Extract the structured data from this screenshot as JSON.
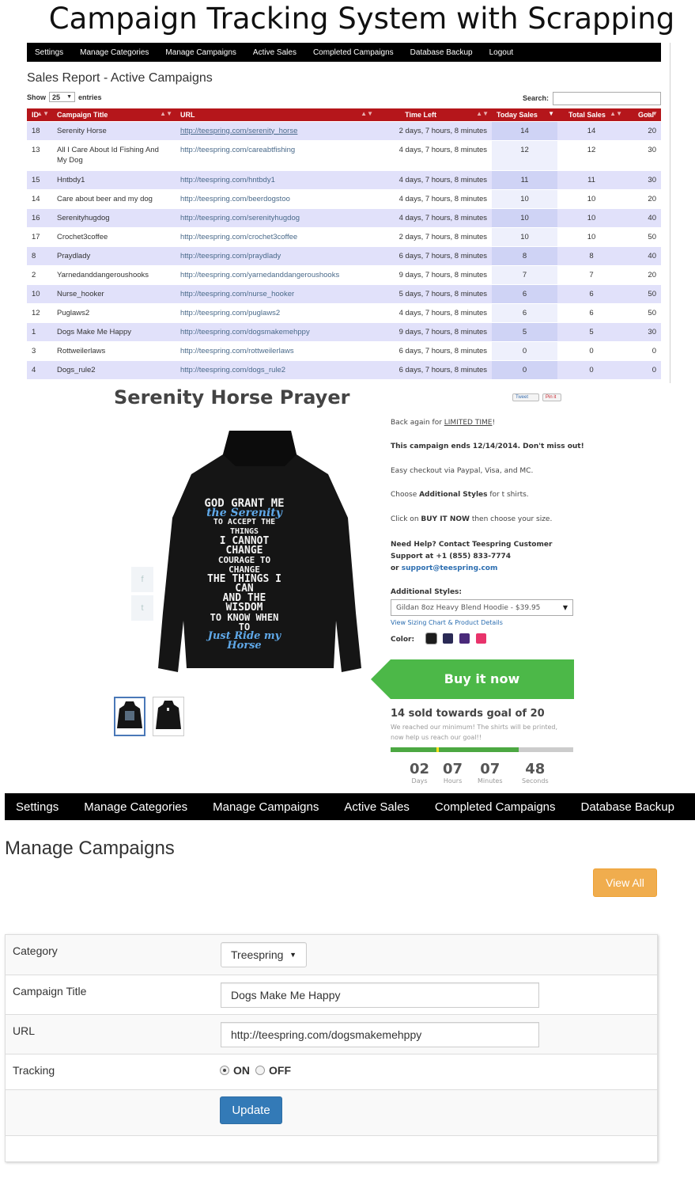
{
  "banner_title": "Campaign Tracking System with Scrapping",
  "nav_top": [
    "Settings",
    "Manage Categories",
    "Manage Campaigns",
    "Active Sales",
    "Completed Campaigns",
    "Database Backup",
    "Logout"
  ],
  "sales_report": {
    "title": "Sales Report - Active Campaigns",
    "show_label": "Show",
    "entries_value": "25",
    "entries_label": "entries",
    "search_label": "Search:",
    "columns": [
      "ID",
      "Campaign Title",
      "URL",
      "Time Left",
      "Today Sales",
      "Total Sales",
      "Goal"
    ],
    "rows": [
      [
        "18",
        "Serenity Horse",
        "http://teespring.com/serenity_horse",
        "2 days, 7 hours, 8 minutes",
        "14",
        "14",
        "20"
      ],
      [
        "13",
        "All I Care About Id Fishing And My Dog",
        "http://teespring.com/careabtfishing",
        "4 days, 7 hours, 8 minutes",
        "12",
        "12",
        "30"
      ],
      [
        "15",
        "Hntbdy1",
        "http://teespring.com/hntbdy1",
        "4 days, 7 hours, 8 minutes",
        "11",
        "11",
        "30"
      ],
      [
        "14",
        "Care about beer and my dog",
        "http://teespring.com/beerdogstoo",
        "4 days, 7 hours, 8 minutes",
        "10",
        "10",
        "20"
      ],
      [
        "16",
        "Serenityhugdog",
        "http://teespring.com/serenityhugdog",
        "4 days, 7 hours, 8 minutes",
        "10",
        "10",
        "40"
      ],
      [
        "17",
        "Crochet3coffee",
        "http://teespring.com/crochet3coffee",
        "2 days, 7 hours, 8 minutes",
        "10",
        "10",
        "50"
      ],
      [
        "8",
        "Praydlady",
        "http://teespring.com/praydlady",
        "6 days, 7 hours, 8 minutes",
        "8",
        "8",
        "40"
      ],
      [
        "2",
        "Yarnedanddangeroushooks",
        "http://teespring.com/yarnedanddangeroushooks",
        "9 days, 7 hours, 8 minutes",
        "7",
        "7",
        "20"
      ],
      [
        "10",
        "Nurse_hooker",
        "http://teespring.com/nurse_hooker",
        "5 days, 7 hours, 8 minutes",
        "6",
        "6",
        "50"
      ],
      [
        "12",
        "Puglaws2",
        "http://teespring.com/puglaws2",
        "4 days, 7 hours, 8 minutes",
        "6",
        "6",
        "50"
      ],
      [
        "1",
        "Dogs Make Me Happy",
        "http://teespring.com/dogsmakemehppy",
        "9 days, 7 hours, 8 minutes",
        "5",
        "5",
        "30"
      ],
      [
        "3",
        "Rottweilerlaws",
        "http://teespring.com/rottweilerlaws",
        "6 days, 7 hours, 8 minutes",
        "0",
        "0",
        "0"
      ],
      [
        "4",
        "Dogs_rule2",
        "http://teespring.com/dogs_rule2",
        "6 days, 7 hours, 8 minutes",
        "0",
        "0",
        "0"
      ]
    ]
  },
  "product": {
    "title": "Serenity Horse Prayer",
    "tweet": "Tweet",
    "pinit": "Pin it",
    "hoodie_lines": [
      "GOD GRANT ME",
      "the Serenity",
      "TO ACCEPT THE THINGS",
      "I CANNOT CHANGE",
      "COURAGE TO CHANGE",
      "THE THINGS I CAN",
      "AND THE WISDOM",
      "TO KNOW WHEN TO",
      "Just Ride my",
      "Horse"
    ],
    "back_again_pre": "Back again for ",
    "back_again_link": "LIMITED TIME",
    "back_again_post": "!",
    "ends": "This campaign ends 12/14/2014. Don't miss out!",
    "checkout": "Easy checkout via Paypal, Visa, and MC.",
    "choose_pre": "Choose ",
    "choose_bold": "Additional Styles",
    "choose_post": " for t shirts.",
    "click_pre": "Click on ",
    "click_bold": "BUY IT NOW",
    "click_post": " then choose your size.",
    "help_line1": "Need Help? Contact Teespring Customer",
    "help_line2": "Support at +1 (855) 833-7774",
    "help_line3_pre": "or ",
    "help_email": "support@teespring.com",
    "additional_styles_label": "Additional Styles:",
    "style_selected": "Gildan 8oz Heavy Blend Hoodie - $39.95",
    "sizing_link": "View Sizing Chart & Product Details",
    "color_label": "Color:",
    "colors": [
      "#1c1c1c",
      "#2a2a55",
      "#4a2a7a",
      "#e8336b"
    ],
    "buy_label": "Buy it now",
    "sold_text": "14 sold towards goal of 20",
    "reached_text": "We reached our minimum! The shirts will be printed, now help us reach our goal!!",
    "progress_fraction": 0.7,
    "countdown": [
      {
        "value": "02",
        "label": "Days"
      },
      {
        "value": "07",
        "label": "Hours"
      },
      {
        "value": "07",
        "label": "Minutes"
      },
      {
        "value": "48",
        "label": "Seconds"
      }
    ]
  },
  "nav_bottom": [
    "Settings",
    "Manage Categories",
    "Manage Campaigns",
    "Active Sales",
    "Completed Campaigns",
    "Database Backup"
  ],
  "manage": {
    "title": "Manage Campaigns",
    "view_all": "View All",
    "category_label": "Category",
    "category_value": "Treespring",
    "campaign_title_label": "Campaign Title",
    "campaign_title_value": "Dogs Make Me Happy",
    "url_label": "URL",
    "url_value": "http://teespring.com/dogsmakemehppy",
    "tracking_label": "Tracking",
    "on_label": "ON",
    "off_label": "OFF",
    "update_label": "Update"
  }
}
